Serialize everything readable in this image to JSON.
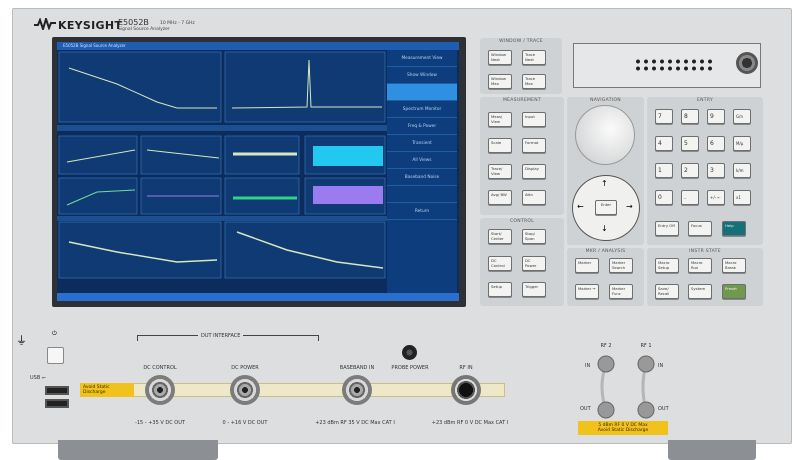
{
  "brand": {
    "name": "KEYSIGHT",
    "model": "E5052B",
    "range": "10 MHz - 7 GHz",
    "description": "Signal Source Analyzer"
  },
  "screen": {
    "title": "E5052B Signal Source Analyzer",
    "softkeys": [
      "Measurement View",
      "Show Window",
      "",
      "Spectrum Monitor",
      "Freq & Power",
      "Transient",
      "All Views",
      "Baseband Noise",
      "",
      "Return"
    ],
    "selected_softkey_index": 2,
    "colors": {
      "background": "#0b2c5c",
      "trace": "#d7e8c0",
      "cyan": "#22c8f0",
      "green": "#2fd38a",
      "purple": "#9a7cf0"
    }
  },
  "window_trace": {
    "title": "WINDOW / TRACE",
    "keys": [
      "Window Next",
      "Trace Next",
      "Window Max",
      "Trace Max"
    ]
  },
  "measurement": {
    "title": "MEASUREMENT",
    "keys": [
      "Meas/ View",
      "Input",
      "Scale",
      "Format",
      "Trace/ View",
      "Display",
      "Avg/ BW",
      "Attn"
    ]
  },
  "control": {
    "title": "CONTROL",
    "keys": [
      "Start/ Center",
      "Stop/ Span",
      "DC Control",
      "DC Power",
      "Setup",
      "Trigger"
    ]
  },
  "navigation": {
    "title": "NAVIGATION",
    "enter": "Enter",
    "arrows": [
      "up",
      "left",
      "right",
      "down"
    ]
  },
  "mkr_analysis": {
    "title": "MKR / ANALYSIS",
    "keys": [
      "Marker",
      "Marker Search",
      "Marker →",
      "Marker Func"
    ]
  },
  "entry": {
    "title": "ENTRY",
    "keys": [
      "7",
      "8",
      "9",
      "G/n",
      "4",
      "5",
      "6",
      "M/μ",
      "1",
      "2",
      "3",
      "k/m",
      "0",
      ".",
      "+/- ←",
      "x1"
    ],
    "bottom_keys": [
      "Entry Off",
      "Focus",
      "Help"
    ]
  },
  "instr_state": {
    "title": "INSTR STATE",
    "keys": [
      "Macro Setup",
      "Macro Run",
      "Macro Break",
      "Save/ Recall",
      "System",
      "Preset"
    ]
  },
  "front": {
    "usb_label": "USB",
    "static_warning": "Avoid Static Discharge",
    "dut_interface": "DUT INTERFACE",
    "connectors": [
      {
        "label": "DC CONTROL",
        "rating": "-15 - +35 V DC OUT"
      },
      {
        "label": "DC POWER",
        "rating": "0 - +16 V DC OUT"
      },
      {
        "label": "BASEBAND IN",
        "rating": "+23 dBm RF 35 V DC Max CAT I"
      },
      {
        "label": "RF IN",
        "rating": "+23 dBm RF 0 V DC Max CAT I"
      }
    ],
    "probe_power": "PROBE POWER",
    "rf_ports": [
      {
        "label": "RF 2",
        "in": "IN",
        "out": "OUT"
      },
      {
        "label": "RF 1",
        "in": "IN",
        "out": "OUT"
      }
    ],
    "rf_warning_1": "5 dBm RF 0 V DC Max",
    "rf_warning_2": "Avoid Static Discharge"
  }
}
